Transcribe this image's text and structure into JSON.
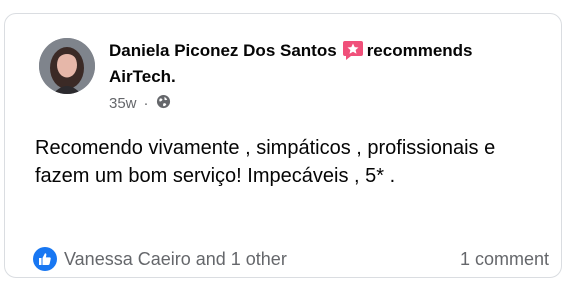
{
  "post": {
    "author": "Daniela Piconez Dos Santos",
    "action": "recommends",
    "page": "AirTech.",
    "time": "35w",
    "separator": "·",
    "audience_icon": "globe-icon",
    "recommend_icon": "recommend-star-icon",
    "text": "Recomendo vivamente , simpáticos , profissionais e fazem um bom serviço! Impecáveis , 5* ."
  },
  "footer": {
    "reaction_icon": "like-icon",
    "reactors": "Vanessa Caeiro and 1 other",
    "comments": "1 comment"
  },
  "colors": {
    "brand_blue": "#1877f2",
    "recommend_pink": "#f0507a",
    "secondary_text": "#65676b",
    "primary_text": "#050505"
  }
}
